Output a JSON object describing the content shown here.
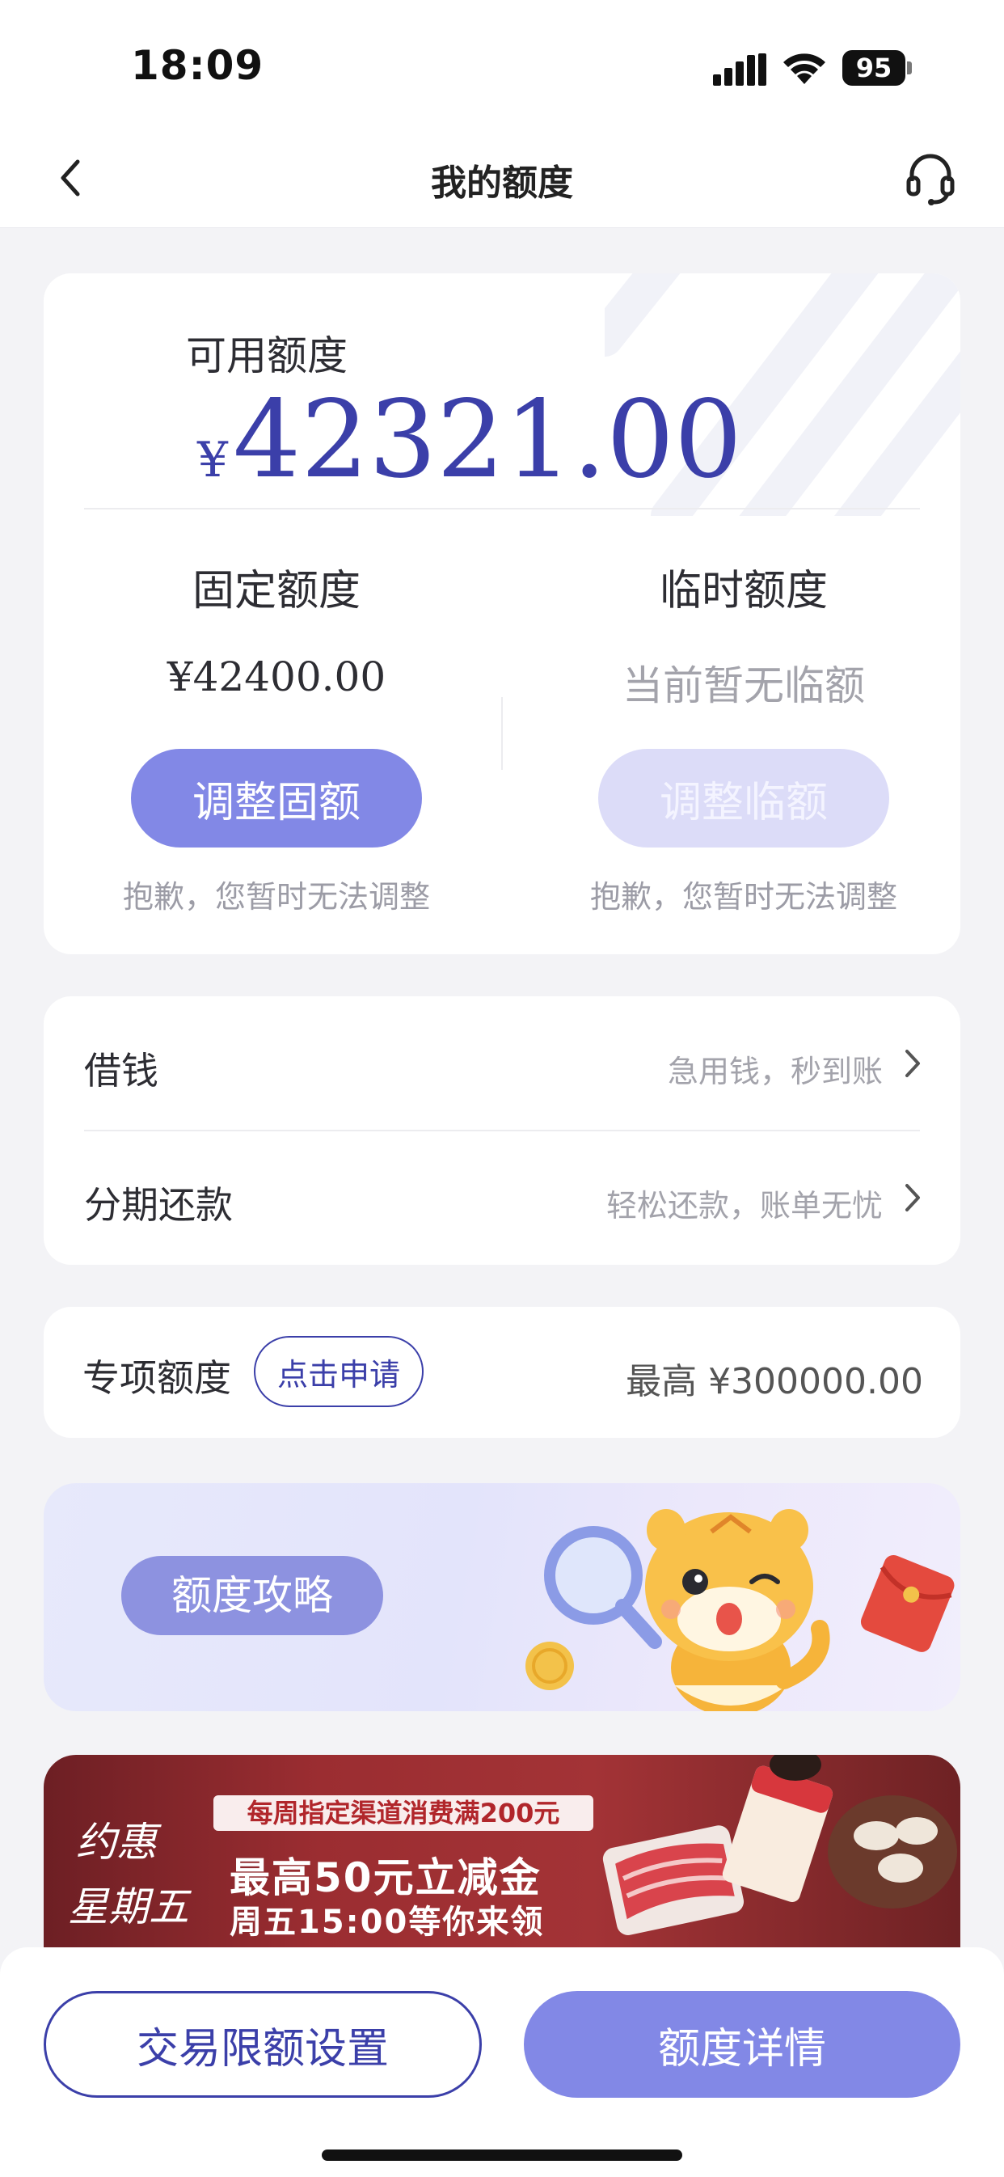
{
  "status_bar": {
    "time": "18:09",
    "battery": "95"
  },
  "nav": {
    "title": "我的额度",
    "back_icon": "chevron-left-icon",
    "service_icon": "headset-icon"
  },
  "credit": {
    "available_label": "可用额度",
    "currency": "¥",
    "available_amount": "42321.00",
    "fixed": {
      "title": "固定额度",
      "value": "¥42400.00",
      "button": "调整固额",
      "note": "抱歉，您暂时无法调整"
    },
    "temporary": {
      "title": "临时额度",
      "value": "当前暂无临额",
      "button": "调整临额",
      "note": "抱歉，您暂时无法调整"
    }
  },
  "list": [
    {
      "title": "借钱",
      "subtitle": "急用钱，秒到账"
    },
    {
      "title": "分期还款",
      "subtitle": "轻松还款，账单无忧"
    }
  ],
  "special": {
    "title": "专项额度",
    "apply_label": "点击申请",
    "max": "最高 ¥300000.00"
  },
  "guide_banner": {
    "label": "额度攻略"
  },
  "promo_banner": {
    "logo_line1": "约惠",
    "logo_line2": "星期五",
    "headline": "每周指定渠道消费满200元",
    "line2": "最高50元立减金",
    "line3": "周五15:00等你来领"
  },
  "bottom": {
    "limit_button": "交易限额设置",
    "detail_button": "额度详情"
  },
  "colors": {
    "brand": "#3b3fa9",
    "button": "#8288e6",
    "button_disabled": "#dcdcf8",
    "background": "#f3f3f6"
  }
}
